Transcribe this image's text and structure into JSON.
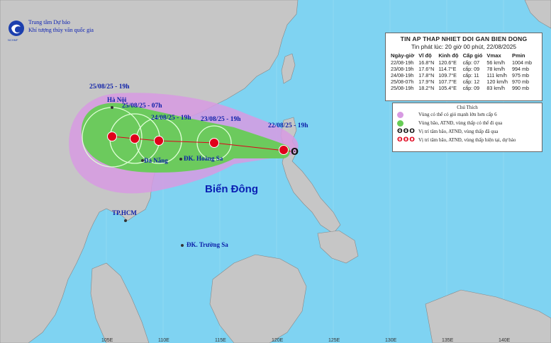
{
  "agency": {
    "line1": "Trung tâm Dự báo",
    "line2": "Khí tượng thủy văn quốc gia",
    "logo_caption": "NCHMF"
  },
  "bulletin": {
    "title": "TIN AP THAP NHIET DOI GAN BIEN DONG",
    "issued": "Tin phát lúc: 20 giờ 00 phút, 22/08/2025",
    "columns": [
      "Ngày-giờ",
      "Vĩ độ",
      "Kinh độ",
      "Cấp gió",
      "Vmax",
      "Pmin"
    ],
    "rows": [
      {
        "time": "22/08-19h",
        "lat": "16.8°N",
        "lon": "120.6°E",
        "level": "cấp: 07",
        "vmax": "56 km/h",
        "pmin": "1004 mb"
      },
      {
        "time": "23/08-19h",
        "lat": "17.6°N",
        "lon": "114.7°E",
        "level": "cấp: 09",
        "vmax": "78 km/h",
        "pmin": "994 mb"
      },
      {
        "time": "24/08-19h",
        "lat": "17.8°N",
        "lon": "109.7°E",
        "level": "cấp: 11",
        "vmax": "111 km/h",
        "pmin": "975 mb"
      },
      {
        "time": "25/08-07h",
        "lat": "17.9°N",
        "lon": "107.7°E",
        "level": "cấp: 12",
        "vmax": "120 km/h",
        "pmin": "970 mb"
      },
      {
        "time": "25/08-19h",
        "lat": "18.2°N",
        "lon": "105.4°E",
        "level": "cấp: 09",
        "vmax": "83 km/h",
        "pmin": "990 mb"
      }
    ]
  },
  "legend": {
    "title": "Chú Thích",
    "items": [
      {
        "label": "Vùng có thể có gió mạnh lớn hơn cấp 6",
        "color": "#d79ae2",
        "icon": "purple-dot"
      },
      {
        "label": "Vùng bão, ATNĐ, vùng thấp có thể đi qua",
        "color": "#66cc55",
        "icon": "green-dot"
      },
      {
        "label": "Vị trí tâm bão, ATNĐ, vùng thấp đã qua",
        "color": "#111111",
        "icon": "black-storm-symbols"
      },
      {
        "label": "Vị trí tâm bão, ATNĐ, vùng thấp hiện tại, dự báo",
        "color": "#e0001a",
        "icon": "red-storm-symbols"
      }
    ]
  },
  "track_labels": [
    {
      "text": "22/08/25 - 19h"
    },
    {
      "text": "23/08/25 - 19h"
    },
    {
      "text": "24/08/25 - 19h"
    },
    {
      "text": "25/08/25 - 07h"
    },
    {
      "text": "25/08/25 - 19h"
    }
  ],
  "places": {
    "hanoi": "Hà Nội",
    "danang": "Đà Nẵng",
    "hoangsa": "ĐK. Hoàng Sa",
    "tphcm": "TP.HCM",
    "truongsa": "ĐK. Trường Sa",
    "biendong": "Biển Đông"
  },
  "longitude_ticks": [
    "105E",
    "110E",
    "115E",
    "120E",
    "125E",
    "130E",
    "135E",
    "140E"
  ],
  "colors": {
    "sea": "#7fd3f2",
    "land": "#c6c6c6",
    "wind_zone": "#d79ae2",
    "cone": "#66cc55",
    "track": "#e0001a"
  }
}
